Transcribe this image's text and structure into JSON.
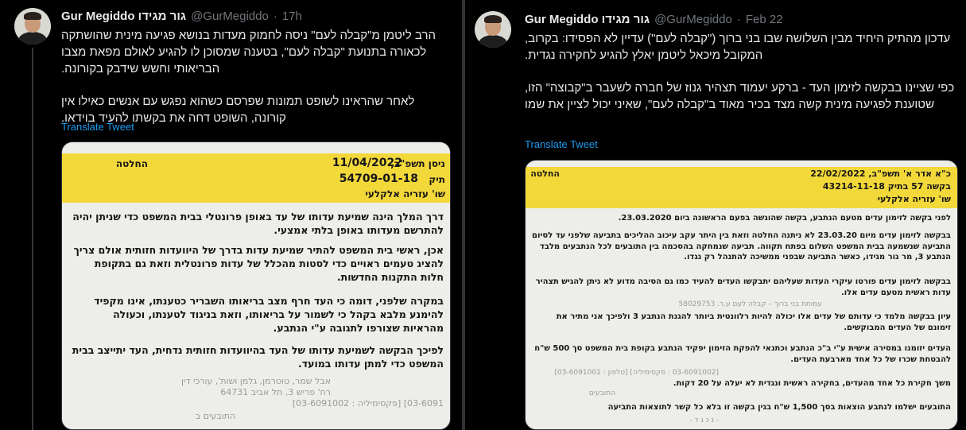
{
  "left": {
    "author": {
      "name": "Gur Megiddo גור מגידו",
      "handle": "@GurMegiddo",
      "sep": "·",
      "time": "17h"
    },
    "paragraph1": "הרב ליטמן מ\"קבלה לעם\" ניסה לחמוק מעדות בנושא פגיעה מינית שהושתקה לכאורה בתנועת \"קבלה לעם\", בטענה שמסוכן לו להגיע לאולם מפאת מצבו הבריאותי וחשש שידבק בקורונה.",
    "paragraph2": "לאחר שהראינו לשופט תמונות שפרסם כשהוא נפגש עם אנשים כאילו אין קורונה, השופט דחה את בקשתו להעיד בוידאו.",
    "translate": "Translate Tweet",
    "doc": {
      "header_decision": "החלטה",
      "header_date": "11/04/2022",
      "header_date_prefix": "ניסן תשפ\"ב,",
      "header_case": "54709-01-18",
      "header_case_label": "תיק",
      "header_judge": "שו' עזריה אלקלעי",
      "p1": "דרך המלך הינה שמיעת עדותו של עד באופן פרונטלי בבית המשפט כדי שניתן יהיה להתרשם מעדותו באופן בלתי אמצעי.",
      "p2": "אכן, ראשי בית המשפט להתיר שמיעת עדות בדרך של היוועדות חזותית אולם צריך להציג טעמים ראויים כדי לסטות מהכלל של עדות פרונטלית וזאת גם בתקופת חלות התקנות החדשות.",
      "p3": "במקרה שלפני, דומה כי העד חרף מצב בריאותו השבריר כטענתו, אינו מקפיד להימנע מלבא בקהל כי לשמור על בריאותו, וזאת בניגוד לטענתו, וכעולה מהראיות שצורפו לתגובה ע\"י הנתבע.",
      "p4": "לפיכך הבקשה לשמיעת עדותו של העד בהיוועדות חזותית נדחית, העד יתייצב בבית המשפט כדי למתן עדותו במועד.",
      "stamp1": "אבל שמר, טוטרמן, גלמן ושות', עורכי דין",
      "stamp2": "רח' פריש 3, תל אביב 64731",
      "stamp3": "[03-6091002 : פקסימיליה] [03-6091",
      "stamp4": "התובעים ב"
    }
  },
  "right": {
    "author": {
      "name": "Gur Megiddo גור מגידו",
      "handle": "@GurMegiddo",
      "sep": "·",
      "time": "Feb 22"
    },
    "paragraph1": "עדכון מהתיק היחיד מבין השלושה שבו בני ברוך (\"קבלה לעם\") עדיין לא הפסידו: בקרוב, המקובל מיכאל ליטמן יאלץ להגיע לחקירה נגדית.",
    "paragraph2": "כפי שציינו בבקשה לזימון העד - ברקע יעמוד תצהיר גנוז של חברה לשעבר ב\"קבוצה\" הזו, שטוענת לפגיעה מינית קשה מצד בכיר מאוד ב\"קבלה לעם\", שאיני יכול לציין את שמו",
    "translate": "Translate Tweet",
    "doc": {
      "header_decision": "החלטה",
      "header_date": "כ\"א אדר א' תשפ\"ב, 22/02/2022",
      "header_request": "בקשה 57 בתיק 43214-11-18",
      "header_judge": "שו' עזריה אלקלעי",
      "p1": "לפני בקשה לזימון עדים מטעם הנתבע, בקשה שהוגשה בפעם הראשונה ביום 23.03.2020.",
      "p2": "בבקשה לזימון עדים מיום 23.03.20 לא ניתנה החלטה וזאת בין היתר עקב עיכוב ההליכים בתביעה שלפני עד לסיום התביעה שנשמעה בבית המשפט השלום בפתח תקווה. תביעה שנמחקה בהסכמה בין התובעים לכל הנתבעים מלבד הנתבע 3, מר גור מגידו, כאשר התביעה שבפני ממשיכה להתנהל רק נגדו.",
      "p3": "בבקשה לזימון עדים פורטו עיקרי העדות שעליהם יתבקשו העדים להעיד כמו גם הסיבה מדוע לא ניתן להגיש תצהיר עדות ראשית מטעם עדים אלו.",
      "p4": "עיון בבקשה מלמד כי עדותם של עדים אלו יכולה להיות רלוונטית ביותר להגנת הנתבע 3 ולפיכך אני מתיר את זימונם של העדים המבוקשים.",
      "p5": "העדים יזומנו במסירה אישית ע\"י ב\"כ הנתבע וכתנאי להפקת הזימון יפקיד הנתבע בקופת בית המשפט סך 500 ש\"ח להבטחת שכרו של כל אחד מארבעת העדים.",
      "p6": "משך חקירת כל אחד מהעדים, בחקירה ראשית ונגדית לא יעלה על 20 דקות.",
      "p7": "התובעים ישלמו לנתבע הוצאות בסך 1,500 ש\"ח בגין בקשה זו בלא כל קשר לתוצאות התביעה",
      "stamp1": "עמותת בני ברוך – קבלה לעם ע.ר. 58029753",
      "stamp2": "התובעים",
      "stamp3": "[03-6091001 : טלפון] [03-6091002 : פקסימיליה]",
      "stamp4": "- נ נ ג ד -"
    }
  },
  "colors": {
    "background": "#000000",
    "text": "#e7e9ea",
    "muted": "#71767b",
    "link": "#1d9bf0",
    "highlight": "#f3d83a"
  },
  "icons": [
    "avatar-photo"
  ]
}
